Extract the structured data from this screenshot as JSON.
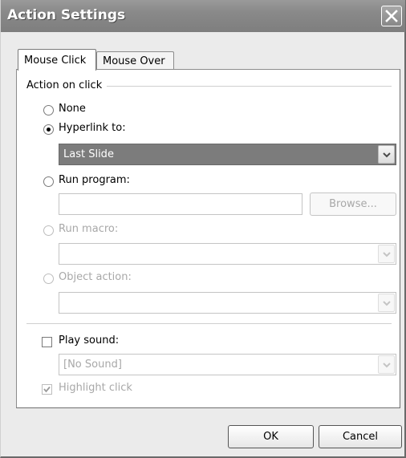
{
  "window": {
    "title": "Action Settings"
  },
  "tabs": [
    {
      "label": "Mouse Click",
      "active": true
    },
    {
      "label": "Mouse Over",
      "active": false
    }
  ],
  "group": {
    "label": "Action on click"
  },
  "options": {
    "none": {
      "label": "None",
      "selected": false,
      "enabled": true
    },
    "hyperlink": {
      "label": "Hyperlink to:",
      "selected": true,
      "enabled": true,
      "value": "Last Slide"
    },
    "run_program": {
      "label": "Run program:",
      "selected": false,
      "enabled": true,
      "value": "",
      "browse_label": "Browse..."
    },
    "run_macro": {
      "label": "Run macro:",
      "selected": false,
      "enabled": false,
      "value": ""
    },
    "object_action": {
      "label": "Object action:",
      "selected": false,
      "enabled": false,
      "value": ""
    }
  },
  "sound": {
    "label": "Play sound:",
    "checked": false,
    "value": "[No Sound]"
  },
  "highlight": {
    "label": "Highlight click",
    "checked": true,
    "enabled": false
  },
  "buttons": {
    "ok": "OK",
    "cancel": "Cancel"
  },
  "icons": {
    "close": "close-icon",
    "dropdown": "chevron-down-icon",
    "check": "checkmark-icon"
  }
}
